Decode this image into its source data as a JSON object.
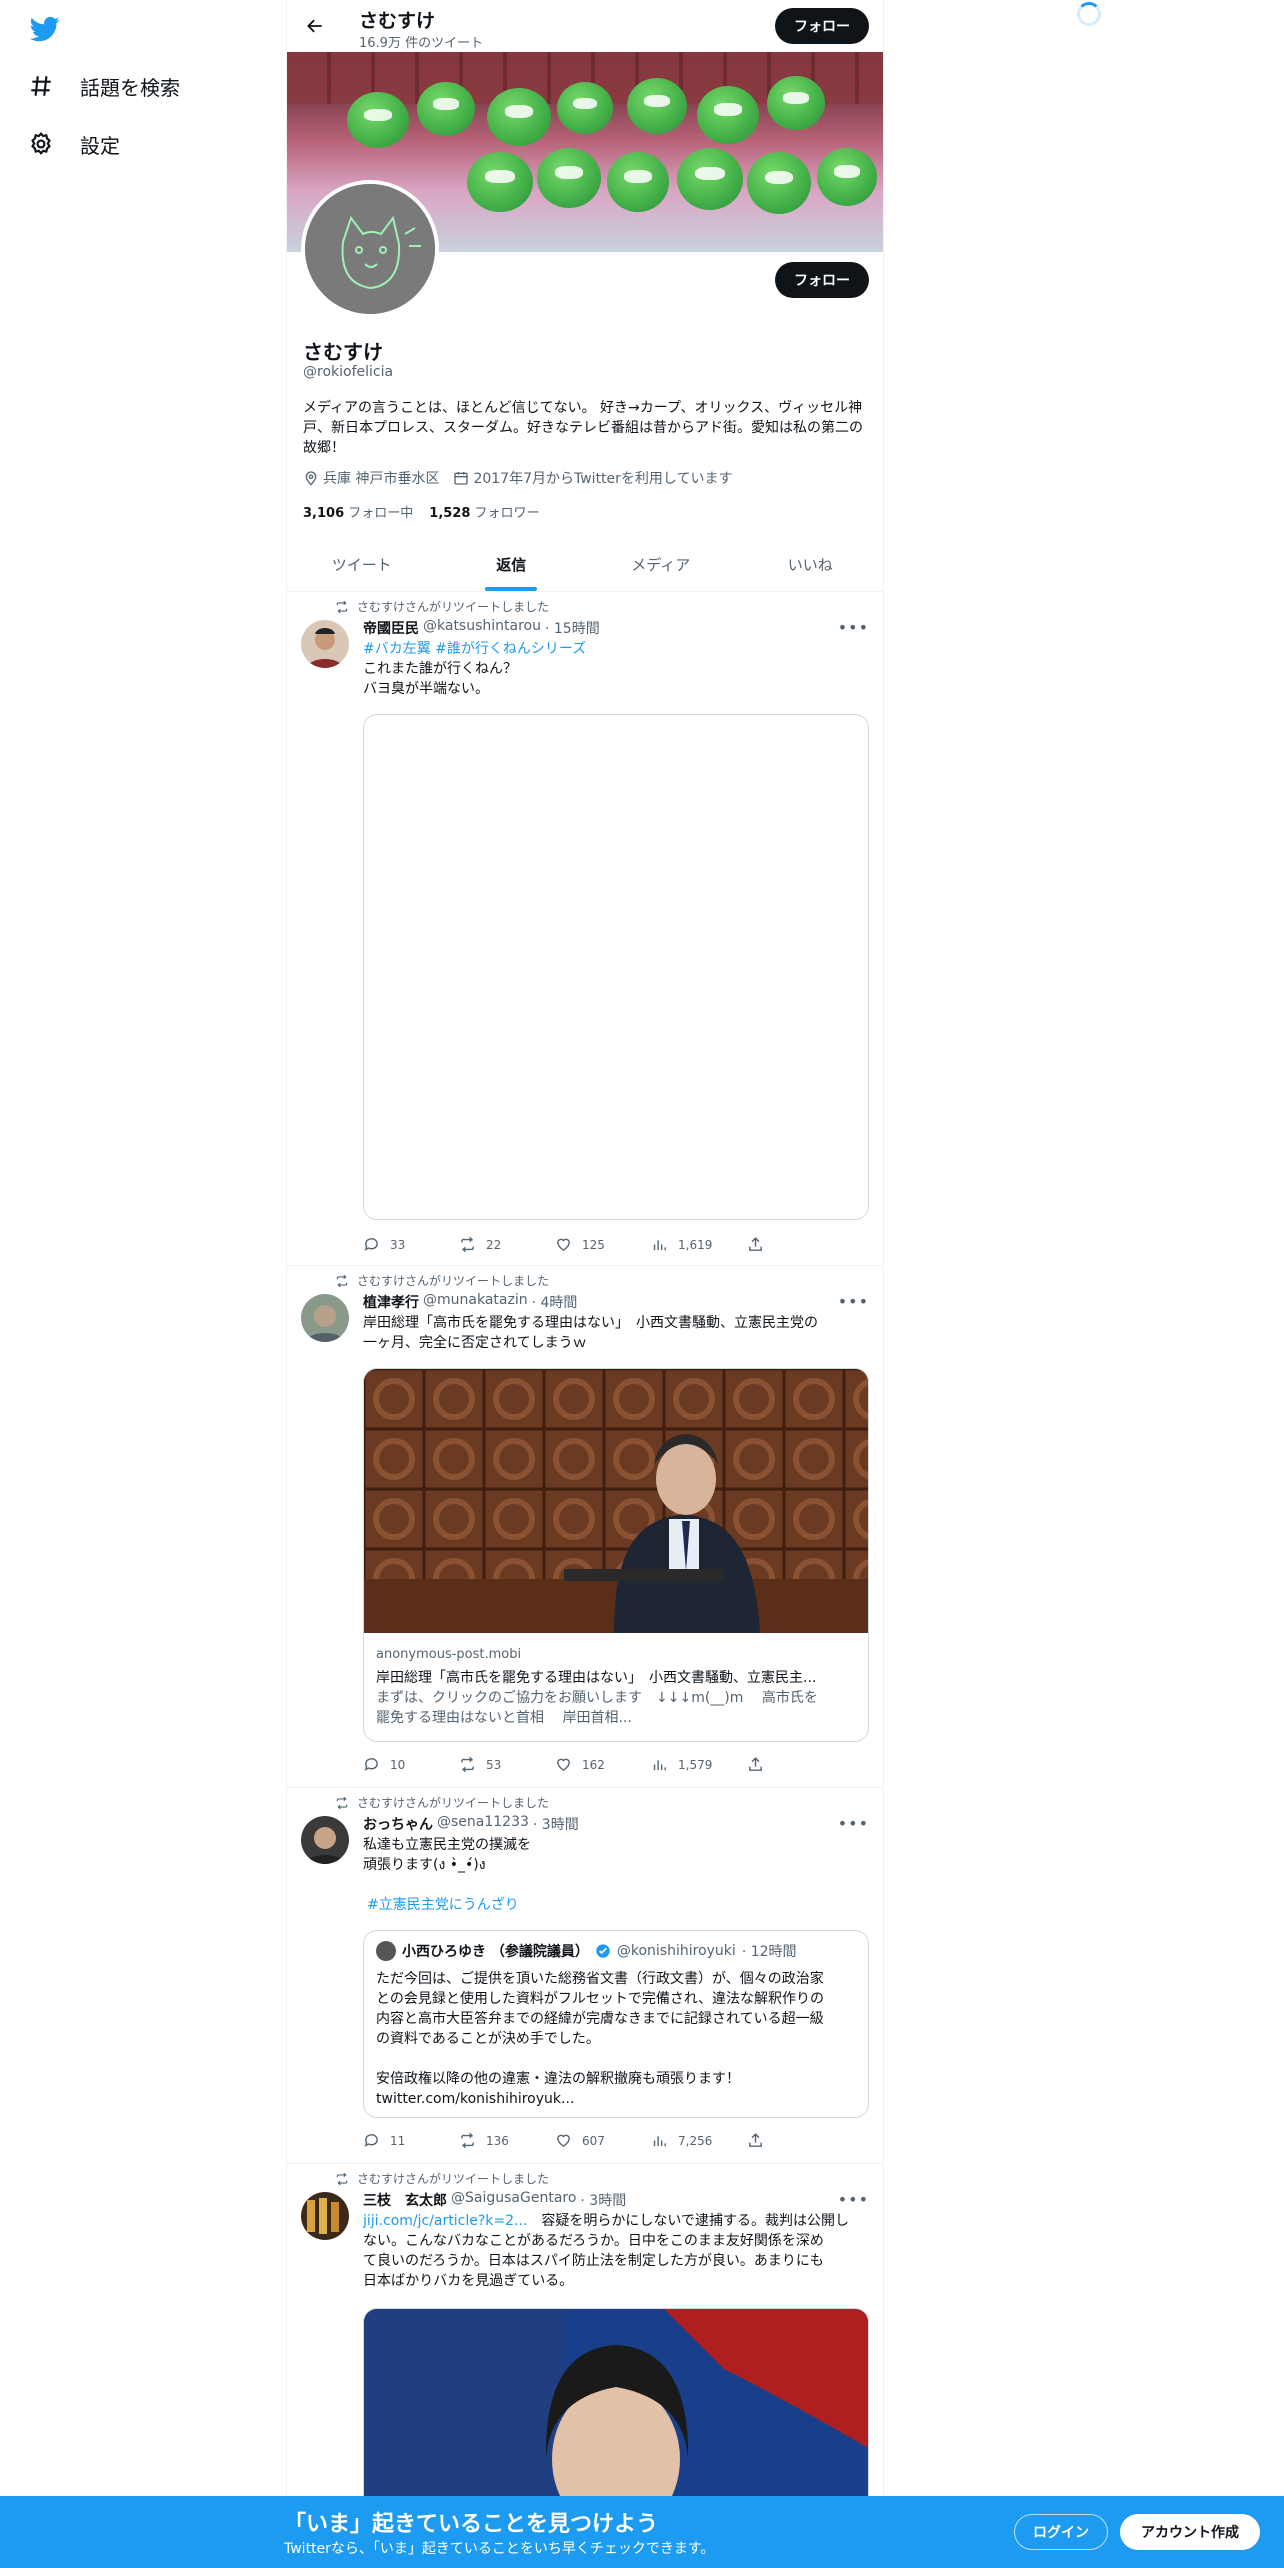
{
  "colors": {
    "accent": "#1d9bf0",
    "text": "#0f1419",
    "muted": "#536471",
    "bottom_bar": "#1d9bf0"
  },
  "nav": {
    "logo_icon": "twitter-bird-icon",
    "items": [
      {
        "label": "話題を検索",
        "icon": "hashtag-icon"
      },
      {
        "label": "設定",
        "icon": "gear-icon"
      }
    ]
  },
  "header": {
    "title": "さむすけ",
    "subtitle": "16.9万 件のツイート",
    "follow_label": "フォロー"
  },
  "profile": {
    "name": "さむすけ",
    "handle": "@rokiofelicia",
    "follow_label": "フォロー",
    "bio": "メディアの言うことは、ほとんど信じてない。 好き→カープ、オリックス、ヴィッセル神戸、新日本プロレス、スターダム。好きなテレビ番組は昔からアド街。愛知は私の第二の故郷！",
    "location": "兵庫 神戸市垂水区",
    "joined": "2017年7月からTwitterを利用しています",
    "following_count": "3,106",
    "following_label": "フォロー中",
    "followers_count": "1,528",
    "followers_label": "フォロワー"
  },
  "tabs": [
    {
      "label": "ツイート"
    },
    {
      "label": "返信",
      "active": true
    },
    {
      "label": "メディア"
    },
    {
      "label": "いいね"
    }
  ],
  "tweets": [
    {
      "retweet_label": "さむすけさんがリツイートしました",
      "name": "帝國臣民",
      "handle": "@katsushintarou",
      "time": "· 15時間",
      "hashtags": "#バカ左翼 #誰が行くねんシリーズ",
      "text_line1": "これまた誰が行くねん？",
      "text_line2": "バヨ臭が半端ない。",
      "replies": "33",
      "retweets": "22",
      "likes": "125",
      "views": "1,619"
    },
    {
      "retweet_label": "さむすけさんがリツイートしました",
      "name": "植津孝行",
      "handle": "@munakatazin",
      "time": "· 4時間",
      "text_line1": "岸田総理「高市氏を罷免する理由はない」　小西文書騒動、立憲民主党の",
      "text_line2": "一ヶ月、完全に否定されてしまうｗ",
      "card_domain": "anonymous-post.mobi",
      "card_title": "岸田総理「高市氏を罷免する理由はない」　小西文書騒動、立憲民主...",
      "card_desc1": "まずは、クリックのご協力をお願いします　↓↓↓m(__)m　 高市氏を",
      "card_desc2": "罷免する理由はないと首相　 岸田首相...",
      "replies": "10",
      "retweets": "53",
      "likes": "162",
      "views": "1,579"
    },
    {
      "retweet_label": "さむすけさんがリツイートしました",
      "name": "おっちゃん",
      "handle": "@sena11233",
      "time": "· 3時間",
      "text_line1": "私達も立憲民主党の撲滅を",
      "text_line2": "頑張ります(ง •̀_•́)ง",
      "hashtag": "#立憲民主党にうんざり",
      "quote": {
        "name": "小西ひろゆき （参議院議員）",
        "handle": "@konishihiroyuki",
        "time": "· 12時間",
        "line1": "ただ今回は、ご提供を頂いた総務省文書（行政文書）が、個々の政治家",
        "line2": "との会見録と使用した資料がフルセットで完備され、違法な解釈作りの",
        "line3": "内容と高市大臣答弁までの経緯が完膚なきまでに記録されている超一級",
        "line4": "の資料であることが決め手でした。",
        "line5": "安倍政権以降の他の違憲・違法の解釈撤廃も頑張ります！",
        "line6": "twitter.com/konishihiroyuk..."
      },
      "replies": "11",
      "retweets": "136",
      "likes": "607",
      "views": "7,256"
    },
    {
      "retweet_label": "さむすけさんがリツイートしました",
      "name": "三枝　玄太郎",
      "handle": "@SaigusaGentaro",
      "time": "· 3時間",
      "link": "jiji.com/jc/article?k=2...",
      "text_line1_rest": "　容疑を明らかにしないで逮捕する。裁判は公開し",
      "text_line2": "ない。こんなバカなことがあるだろうか。日中をこのまま友好関係を深め",
      "text_line3": "て良いのだろうか。日本はスパイ防止法を制定した方が良い。あまりにも",
      "text_line4": "日本ばかりバカを見過ぎている。"
    }
  ],
  "bottom_bar": {
    "headline": "「いま」起きていることを見つけよう",
    "subtext": "Twitterなら、「いま」起きていることをいち早くチェックできます。",
    "login_label": "ログイン",
    "signup_label": "アカウント作成"
  }
}
